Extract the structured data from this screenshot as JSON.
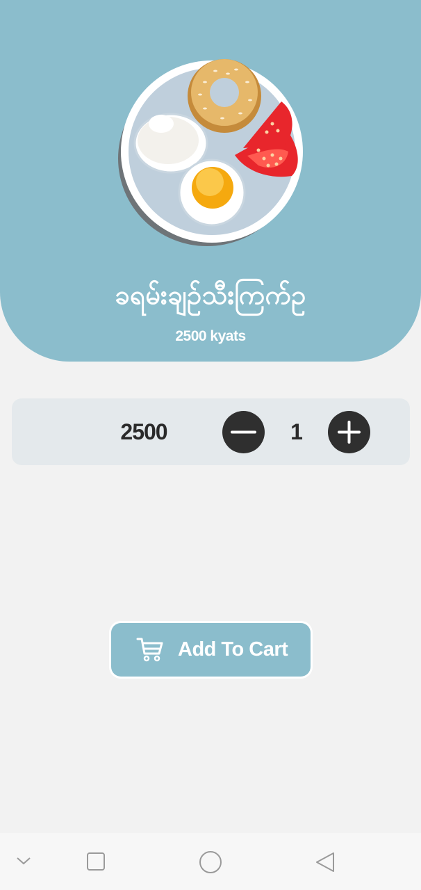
{
  "product": {
    "name": "ခရမ်းချဉ်သီးကြက်ဥ",
    "price": "2500 kyats",
    "image_icon": "breakfast-plate-icon"
  },
  "quantity_selector": {
    "total": "2500",
    "quantity": "1",
    "decrease_icon": "minus-icon",
    "increase_icon": "plus-icon"
  },
  "cart_button": {
    "label": "Add To Cart",
    "icon": "cart-icon"
  },
  "navigation_bar": {
    "items": [
      "chevron-down-icon",
      "square-icon",
      "circle-icon",
      "back-triangle-icon"
    ]
  },
  "colors": {
    "accent": "#8bbdcc",
    "background": "#f2f2f2",
    "card": "#e4e9ec",
    "button_dark": "#2f2f2f"
  }
}
